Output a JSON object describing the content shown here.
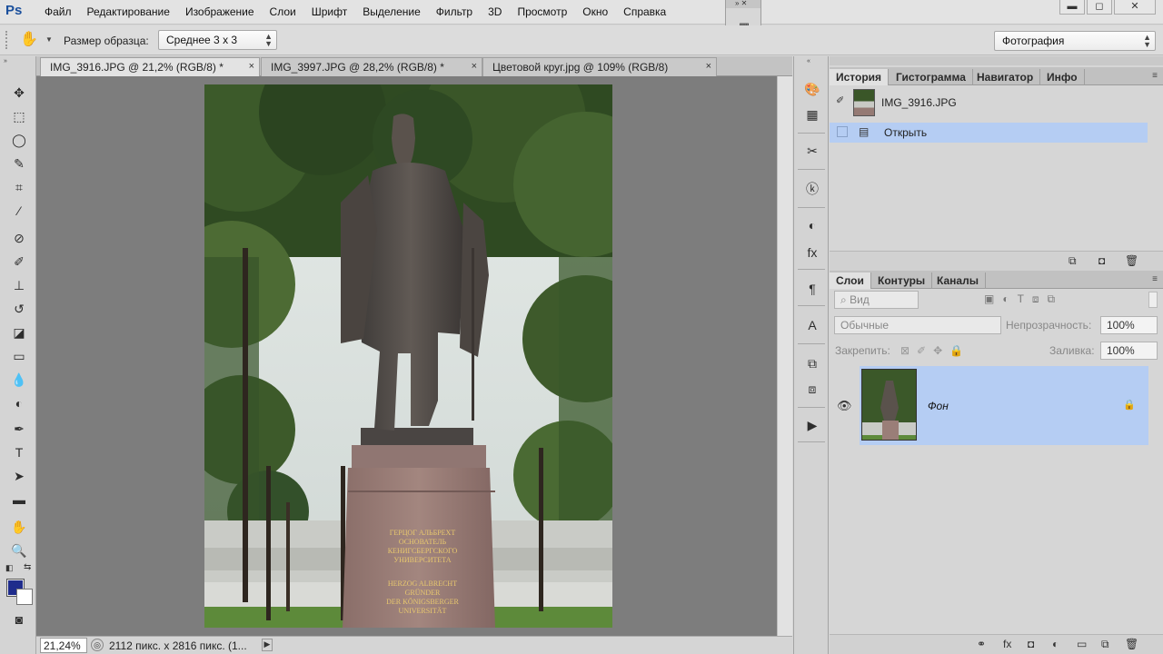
{
  "app": {
    "logo": "Ps"
  },
  "menu": [
    "Файл",
    "Редактирование",
    "Изображение",
    "Слои",
    "Шрифт",
    "Выделение",
    "Фильтр",
    "3D",
    "Просмотр",
    "Окно",
    "Справка"
  ],
  "window_buttons": {
    "minimize": "▬",
    "restore": "◻",
    "close": "✕"
  },
  "options_bar": {
    "sample_size_label": "Размер образца:",
    "sample_size_value": "Среднее 3 х 3",
    "workspace_value": "Фотография"
  },
  "tabs": [
    {
      "label": "IMG_3916.JPG @ 21,2% (RGB/8) *",
      "close": "×"
    },
    {
      "label": "IMG_3997.JPG @ 28,2% (RGB/8) *",
      "close": "×"
    },
    {
      "label": "Цветовой круг.jpg @ 109% (RGB/8)",
      "close": "×"
    }
  ],
  "colors": {
    "foreground": "#1f2c8c",
    "background": "#ffffff",
    "accent_selection": "#b5cdf3"
  },
  "status": {
    "zoom": "21,24%",
    "doc_info": "2112 пикс. x 2816 пикс. (1..."
  },
  "photo": {
    "plaque_ru": [
      "ГЕРЦОГ АЛЬБРЕХТ",
      "ОСНОВАТЕЛЬ",
      "КЕНИГСБЕРГСКОГО",
      "УНИВЕРСИТЕТА"
    ],
    "plaque_de": [
      "HERZOG ALBRECHT",
      "GRÜNDER",
      "DER KÖNIGSBERGER",
      "UNIVERSITÄT"
    ]
  },
  "history_panel": {
    "tabs": [
      "История",
      "Гистограмма",
      "Навигатор",
      "Инфо"
    ],
    "snapshot_name": "IMG_3916.JPG",
    "step": "Открыть"
  },
  "layers_panel": {
    "tabs": [
      "Слои",
      "Контуры",
      "Каналы"
    ],
    "filter_placeholder": "Вид",
    "blend_mode": "Обычные",
    "opacity_label": "Непрозрачность:",
    "opacity_value": "100%",
    "lock_label": "Закрепить:",
    "fill_label": "Заливка:",
    "fill_value": "100%",
    "layer_name": "Фон"
  }
}
